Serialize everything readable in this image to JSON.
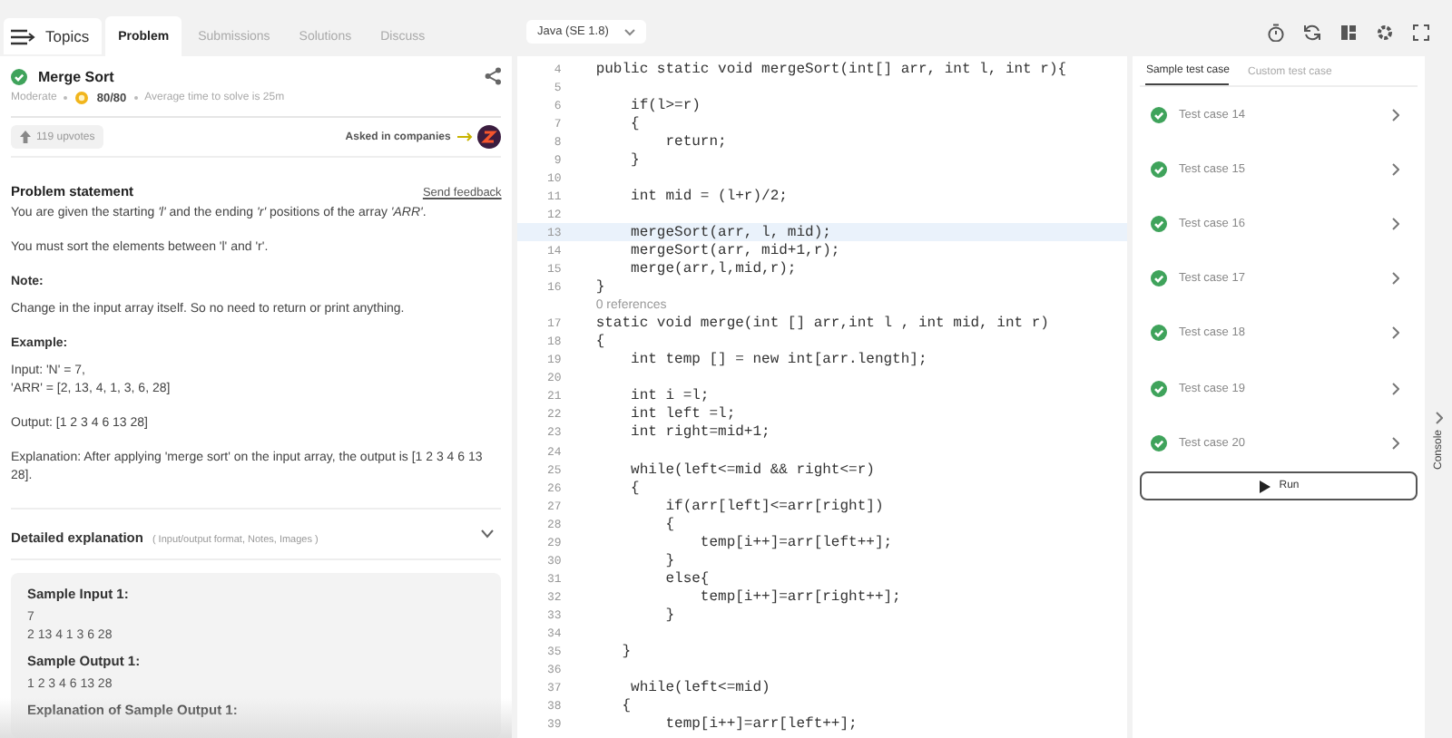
{
  "header": {
    "topics_button": {
      "label": "Topics"
    },
    "tabs": [
      {
        "label": "Problem",
        "selected": true
      },
      {
        "label": "Submissions",
        "selected": false
      },
      {
        "label": "Solutions",
        "selected": false
      },
      {
        "label": "Discuss",
        "selected": false
      }
    ],
    "language_select": {
      "value": "Java (SE 1.8)"
    }
  },
  "problem": {
    "title": "Merge Sort",
    "solved": true,
    "difficulty": "Moderate",
    "score": "80/80",
    "avg_time": "Average time to solve is 25m",
    "upvotes": "119 upvotes",
    "companies_label": "Asked in companies",
    "statement_heading": "Problem statement",
    "feedback_link": "Send feedback",
    "body": [
      {
        "kind": "para",
        "text": "You are given the starting *'l'* and the ending *'r'* positions of the array *'ARR'*."
      },
      {
        "kind": "para",
        "text": "You must sort the elements between 'l' and 'r'."
      },
      {
        "kind": "heading",
        "text": "Note:"
      },
      {
        "kind": "para",
        "text": "Change in the input array itself. So no need to return or print anything."
      },
      {
        "kind": "heading",
        "text": "Example:"
      },
      {
        "kind": "line",
        "text": "Input: 'N' = 7,"
      },
      {
        "kind": "para",
        "text": "'ARR' = [2, 13, 4, 1, 3, 6, 28]"
      },
      {
        "kind": "para",
        "text": "Output: [1 2 3 4 6 13 28]"
      },
      {
        "kind": "para",
        "text": "Explanation: After applying 'merge sort' on the input array, the output is [1 2 3 4 6 13 28]."
      }
    ],
    "detailed": {
      "title": "Detailed explanation",
      "hint": "( Input/output format, Notes, Images )",
      "expanded": false
    },
    "samples": [
      {
        "kind": "heading",
        "text": "Sample Input 1:"
      },
      {
        "kind": "line",
        "text": "7"
      },
      {
        "kind": "line",
        "text": "2 13 4 1 3 6 28"
      },
      {
        "kind": "heading",
        "text": "Sample Output 1:"
      },
      {
        "kind": "line",
        "text": "1 2 3 4 6 13 28"
      },
      {
        "kind": "heading",
        "text": "Explanation of Sample Output 1:"
      }
    ]
  },
  "editor": {
    "lines": [
      {
        "kind": "code",
        "number": "4",
        "text": "public static void mergeSort(int[] arr, int l, int r){",
        "highlighted": false
      },
      {
        "kind": "code",
        "number": "5",
        "highlighted": false
      },
      {
        "kind": "code",
        "number": "6",
        "text": "    if(l>=r)",
        "highlighted": false
      },
      {
        "kind": "code",
        "number": "7",
        "text": "    {",
        "highlighted": false
      },
      {
        "kind": "code",
        "number": "8",
        "text": "        return;",
        "highlighted": false
      },
      {
        "kind": "code",
        "number": "9",
        "text": "    }",
        "highlighted": false
      },
      {
        "kind": "code",
        "number": "10",
        "highlighted": false
      },
      {
        "kind": "code",
        "number": "11",
        "text": "    int mid = (l+r)/2;",
        "highlighted": false
      },
      {
        "kind": "code",
        "number": "12",
        "highlighted": false
      },
      {
        "kind": "code",
        "number": "13",
        "text": "    mergeSort(arr, l, mid);",
        "highlighted": true
      },
      {
        "kind": "code",
        "number": "14",
        "text": "    mergeSort(arr, mid+1,r);",
        "highlighted": false
      },
      {
        "kind": "code",
        "number": "15",
        "text": "    merge(arr,l,mid,r);",
        "highlighted": false
      },
      {
        "kind": "code",
        "number": "16",
        "text": "}",
        "highlighted": false
      },
      {
        "kind": "lens",
        "text": "0 references"
      },
      {
        "kind": "code",
        "number": "17",
        "text": "static void merge(int [] arr,int l , int mid, int r)",
        "highlighted": false
      },
      {
        "kind": "code",
        "number": "18",
        "text": "{",
        "highlighted": false
      },
      {
        "kind": "code",
        "number": "19",
        "text": "    int temp [] = new int[arr.length];",
        "highlighted": false
      },
      {
        "kind": "code",
        "number": "20",
        "highlighted": false
      },
      {
        "kind": "code",
        "number": "21",
        "text": "    int i =l;",
        "highlighted": false
      },
      {
        "kind": "code",
        "number": "22",
        "text": "    int left =l;",
        "highlighted": false
      },
      {
        "kind": "code",
        "number": "23",
        "text": "    int right=mid+1;",
        "highlighted": false
      },
      {
        "kind": "code",
        "number": "24",
        "highlighted": false
      },
      {
        "kind": "code",
        "number": "25",
        "text": "    while(left<=mid && right<=r)",
        "highlighted": false
      },
      {
        "kind": "code",
        "number": "26",
        "text": "    {",
        "highlighted": false
      },
      {
        "kind": "code",
        "number": "27",
        "text": "        if(arr[left]<=arr[right])",
        "highlighted": false
      },
      {
        "kind": "code",
        "number": "28",
        "text": "        {",
        "highlighted": false
      },
      {
        "kind": "code",
        "number": "29",
        "text": "            temp[i++]=arr[left++];",
        "highlighted": false
      },
      {
        "kind": "code",
        "number": "30",
        "text": "        }",
        "highlighted": false
      },
      {
        "kind": "code",
        "number": "31",
        "text": "        else{",
        "highlighted": false
      },
      {
        "kind": "code",
        "number": "32",
        "text": "            temp[i++]=arr[right++];",
        "highlighted": false
      },
      {
        "kind": "code",
        "number": "33",
        "text": "        }",
        "highlighted": false
      },
      {
        "kind": "code",
        "number": "34",
        "highlighted": false
      },
      {
        "kind": "code",
        "number": "35",
        "text": "   }",
        "highlighted": false
      },
      {
        "kind": "code",
        "number": "36",
        "highlighted": false
      },
      {
        "kind": "code",
        "number": "37",
        "text": "    while(left<=mid)",
        "highlighted": false
      },
      {
        "kind": "code",
        "number": "38",
        "text": "   {",
        "highlighted": false
      },
      {
        "kind": "code",
        "number": "39",
        "text": "        temp[i++]=arr[left++];",
        "highlighted": false
      }
    ]
  },
  "tests": {
    "tabs": [
      {
        "label": "Sample test case",
        "selected": true
      },
      {
        "label": "Custom test case",
        "selected": false
      }
    ],
    "cases": [
      {
        "label": "Test case 14",
        "passed": true
      },
      {
        "label": "Test case 15",
        "passed": true
      },
      {
        "label": "Test case 16",
        "passed": true
      },
      {
        "label": "Test case 17",
        "passed": true
      },
      {
        "label": "Test case 18",
        "passed": true
      },
      {
        "label": "Test case 19",
        "passed": true
      },
      {
        "label": "Test case 20",
        "passed": true
      }
    ],
    "run_button": "Run"
  },
  "console_toggle": "Console"
}
